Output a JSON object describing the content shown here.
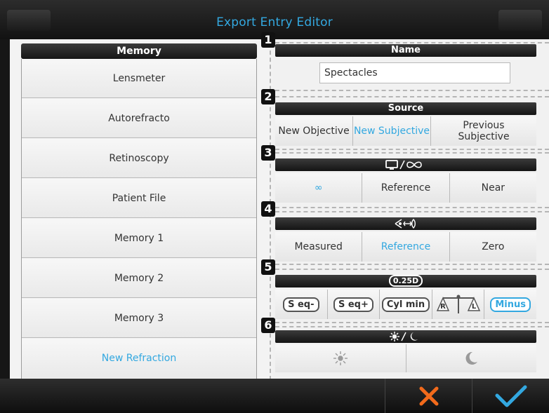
{
  "header": {
    "title": "Export Entry Editor"
  },
  "memory": {
    "title": "Memory",
    "items": [
      {
        "label": "Lensmeter"
      },
      {
        "label": "Autorefracto"
      },
      {
        "label": "Retinoscopy"
      },
      {
        "label": "Patient File"
      },
      {
        "label": "Memory 1"
      },
      {
        "label": "Memory 2"
      },
      {
        "label": "Memory 3"
      },
      {
        "label": "New Refraction"
      }
    ]
  },
  "sections": {
    "name": {
      "number": "1",
      "title": "Name",
      "value": "Spectacles"
    },
    "source": {
      "number": "2",
      "title": "Source",
      "options": [
        "New Objective",
        "New Subjective",
        "Previous Subjective"
      ]
    },
    "distance": {
      "number": "3",
      "title_icon": "monitor-infinity-icon",
      "options": [
        "∞",
        "Reference",
        "Near"
      ]
    },
    "vertex": {
      "number": "4",
      "title_icon": "eye-vertex-icon",
      "options": [
        "Measured",
        "Reference",
        "Zero"
      ]
    },
    "rounding": {
      "number": "5",
      "title": "0.25D",
      "options": [
        "S eq-",
        "S eq+",
        "Cyl min",
        "R",
        "L",
        "Minus"
      ]
    },
    "lighting": {
      "number": "6",
      "title_icon": "sun-moon-icon",
      "options": [
        "sun-icon",
        "moon-icon"
      ]
    }
  },
  "colors": {
    "accent": "#33a8e0",
    "cancel": "#f26a1b",
    "confirm": "#33a8e0"
  }
}
